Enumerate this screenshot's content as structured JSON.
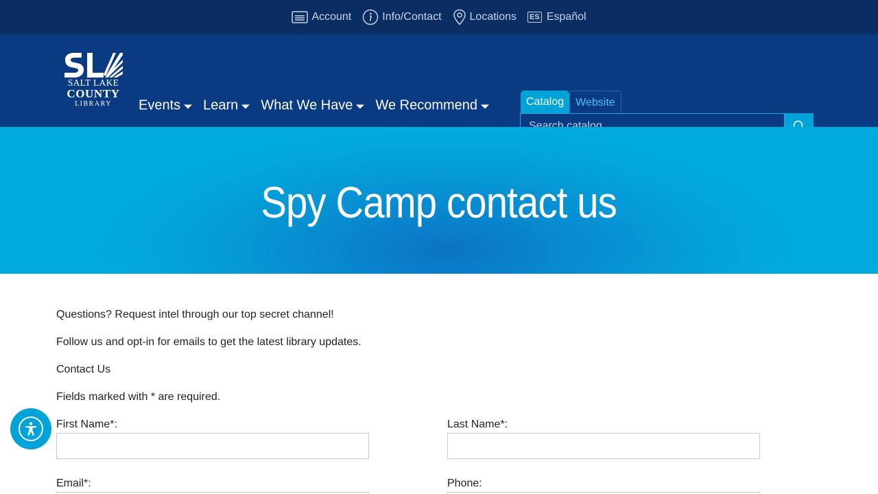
{
  "utility_bar": {
    "items": [
      {
        "label": "Account",
        "icon": "account-card-icon"
      },
      {
        "label": "Info/Contact",
        "icon": "info-icon"
      },
      {
        "label": "Locations",
        "icon": "location-pin-icon"
      },
      {
        "label": "Español",
        "icon": "es-language-icon",
        "badge": "ES"
      }
    ]
  },
  "logo": {
    "line1": "SALT LAKE",
    "line2": "COUNTY",
    "line3": "LIBRARY"
  },
  "nav": {
    "items": [
      {
        "label": "Events"
      },
      {
        "label": "Learn"
      },
      {
        "label": "What We Have"
      },
      {
        "label": "We Recommend"
      }
    ]
  },
  "search": {
    "tabs": [
      {
        "label": "Catalog",
        "active": true
      },
      {
        "label": "Website",
        "active": false
      }
    ],
    "placeholder": "Search catalog",
    "button_icon": "search-icon"
  },
  "hero": {
    "title": "Spy Camp contact us"
  },
  "content": {
    "paragraphs": [
      "Questions? Request intel through our top secret channel!",
      "Follow us and opt-in for emails to get the latest library updates.",
      "Contact Us",
      "Fields marked with * are required."
    ],
    "fields": [
      {
        "label": "First Name*:",
        "value": ""
      },
      {
        "label": "Last Name*:",
        "value": ""
      },
      {
        "label": "Email*:",
        "value": ""
      },
      {
        "label": "Phone:",
        "value": ""
      }
    ]
  },
  "colors": {
    "utility_bg": "#0a2d63",
    "nav_bg": "#0a3a82",
    "accent": "#00a3d8",
    "hero_center": "#0b73c4"
  }
}
